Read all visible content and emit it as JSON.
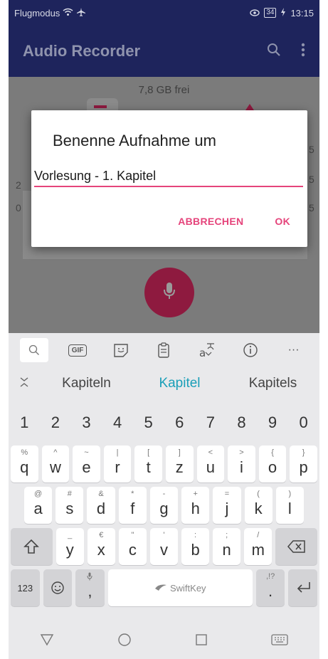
{
  "status_bar": {
    "mode_label": "Flugmodus",
    "battery": "34",
    "time": "13:15"
  },
  "app_bar": {
    "title": "Audio Recorder",
    "search_icon": "search-icon",
    "menu_icon": "more-vert-icon"
  },
  "content": {
    "free_space": "7,8 GB frei",
    "peek_left_1": "2",
    "peek_left_2": "0",
    "peek_right_1": "5",
    "peek_right_2": "5",
    "peek_right_3": "5"
  },
  "dialog": {
    "title": "Benenne Aufnahme um",
    "input_value": "Vorlesung - 1. Kapitel",
    "cancel_label": "ABBRECHEN",
    "ok_label": "OK",
    "accent": "#e5447b"
  },
  "keyboard": {
    "toolbar": {
      "gif": "GIF",
      "more": "···"
    },
    "suggestions": [
      "Kapiteln",
      "Kapitel",
      "Kapitels"
    ],
    "numbers": [
      "1",
      "2",
      "3",
      "4",
      "5",
      "6",
      "7",
      "8",
      "9",
      "0"
    ],
    "row1": [
      {
        "k": "q",
        "s": "%"
      },
      {
        "k": "w",
        "s": "^"
      },
      {
        "k": "e",
        "s": "~"
      },
      {
        "k": "r",
        "s": "|"
      },
      {
        "k": "t",
        "s": "["
      },
      {
        "k": "z",
        "s": "]"
      },
      {
        "k": "u",
        "s": "<"
      },
      {
        "k": "i",
        "s": ">"
      },
      {
        "k": "o",
        "s": "{"
      },
      {
        "k": "p",
        "s": "}"
      }
    ],
    "row2": [
      {
        "k": "a",
        "s": "@"
      },
      {
        "k": "s",
        "s": "#"
      },
      {
        "k": "d",
        "s": "&"
      },
      {
        "k": "f",
        "s": "*"
      },
      {
        "k": "g",
        "s": "-"
      },
      {
        "k": "h",
        "s": "+"
      },
      {
        "k": "j",
        "s": "="
      },
      {
        "k": "k",
        "s": "("
      },
      {
        "k": "l",
        "s": ")"
      }
    ],
    "row3": [
      {
        "k": "y",
        "s": "_"
      },
      {
        "k": "x",
        "s": "€"
      },
      {
        "k": "c",
        "s": "\""
      },
      {
        "k": "v",
        "s": "'"
      },
      {
        "k": "b",
        "s": ":"
      },
      {
        "k": "n",
        "s": ";"
      },
      {
        "k": "m",
        "s": "/"
      }
    ],
    "bottom": {
      "num_label": "123",
      "comma": ",",
      "space_label": "SwiftKey",
      "period": ".",
      "period_sec": ",!?"
    }
  }
}
